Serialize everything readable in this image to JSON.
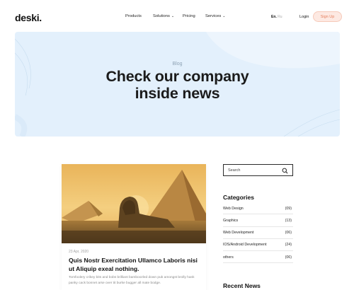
{
  "header": {
    "logo": "deski.",
    "nav": [
      {
        "label": "Products",
        "has_dropdown": false
      },
      {
        "label": "Solutions",
        "has_dropdown": true
      },
      {
        "label": "Pricing",
        "has_dropdown": false
      },
      {
        "label": "Services",
        "has_dropdown": true
      }
    ],
    "language": {
      "active": "En.",
      "inactive": "Ru"
    },
    "login_label": "Login",
    "signup_label": "Sign Up"
  },
  "hero": {
    "tag": "Blog",
    "title_line1": "Check our company",
    "title_line2": "inside news"
  },
  "post": {
    "date": "23 Apr, 2020",
    "title": "Quis Nostr Exercitation Ullamco Laboris nisi ut Aliquip exeal nothing.",
    "excerpt": "Tomfoolery crikey bits and bobs brilliant bamboozled down pub amongst brolly hank panky cack bonnet arse over tit burke bugger all mate bodge.",
    "image_icon": "pyramids-sphinx-photo"
  },
  "sidebar": {
    "search_placeholder": "Search",
    "search_icon": "search-icon",
    "categories_title": "Categories",
    "categories": [
      {
        "name": "Web Design",
        "count": "(09)"
      },
      {
        "name": "Graphics",
        "count": "(13)"
      },
      {
        "name": "Web Development",
        "count": "(06)"
      },
      {
        "name": "IOS/Android Development",
        "count": "(24)"
      },
      {
        "name": "others",
        "count": "(06)"
      }
    ],
    "recent_news_title": "Recent News"
  },
  "colors": {
    "hero_background": "#e3f0fc",
    "signup_background": "#fde9e2",
    "signup_text": "#e6805f"
  }
}
